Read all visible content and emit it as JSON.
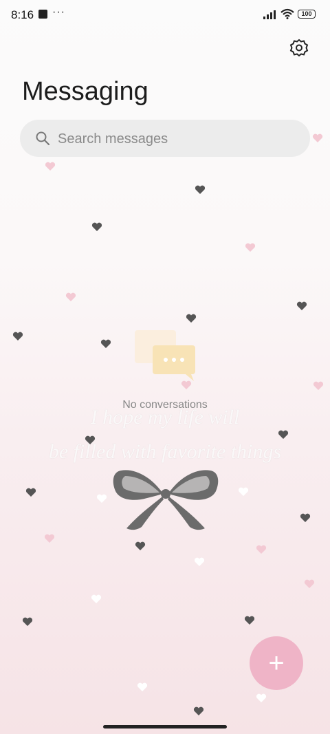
{
  "status_bar": {
    "time": "8:16",
    "overflow": "···",
    "battery": "100"
  },
  "header": {
    "title": "Messaging"
  },
  "search": {
    "placeholder": "Search messages"
  },
  "empty_state": {
    "text": "No conversations"
  },
  "wallpaper": {
    "quote_line1": "I hope my life will",
    "quote_line2": "be filled with favorite things"
  },
  "colors": {
    "fab": "#efb4c7",
    "bubble": "#f7e2b3",
    "bow": "#6b6b6b"
  },
  "icons": [
    "signal-icon",
    "wifi-icon",
    "battery-icon",
    "settings-gear-icon",
    "search-icon",
    "chat-bubbles-icon",
    "bow-icon",
    "plus-icon"
  ]
}
